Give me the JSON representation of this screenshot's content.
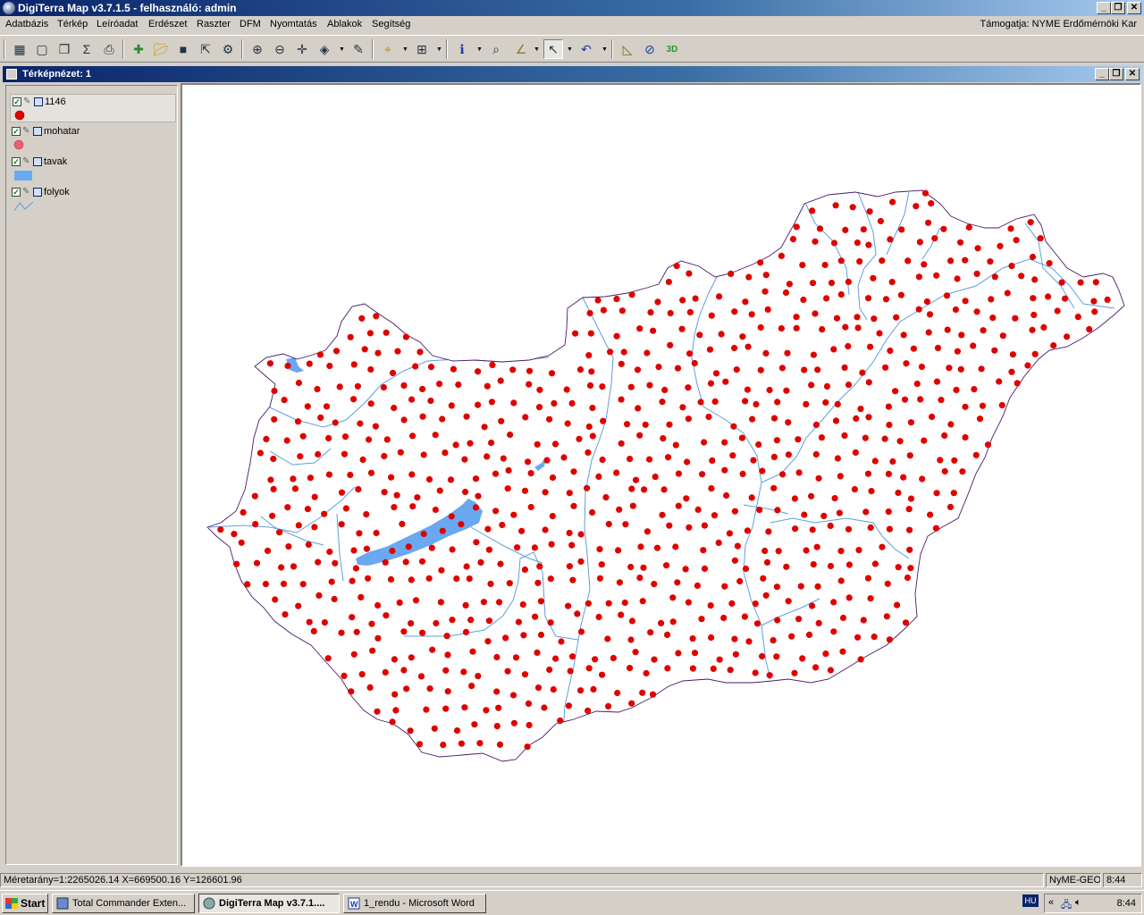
{
  "app": {
    "title": "DigiTerra Map v3.7.1.5 - felhasználó: admin"
  },
  "menu": {
    "items": [
      "Adatbázis",
      "Térkép",
      "Leíróadat",
      "Erdészet",
      "Raszter",
      "DFM",
      "Nyomtatás",
      "Ablakok",
      "Segítség"
    ],
    "support": "Támogatja: NYME Erdőmérnöki Kar"
  },
  "toolbar": {
    "icons": [
      "layers-icon",
      "new-map-icon",
      "window-icon",
      "statistics-icon",
      "print-preview-icon",
      "add-layer-icon",
      "open-icon",
      "save-icon",
      "export-icon",
      "settings-icon",
      "zoom-in-icon",
      "zoom-out-icon",
      "pan-icon",
      "layer-stack-icon",
      "paint-icon",
      "select-point-icon",
      "properties-icon",
      "info-icon",
      "search-icon",
      "measure-icon",
      "label-tool-icon",
      "undo-icon",
      "ruler-icon",
      "compass-icon",
      "3d-icon"
    ]
  },
  "map_window": {
    "title": "Térképnézet: 1"
  },
  "legend": {
    "layers": [
      {
        "name": "1146",
        "checked": true,
        "symbol": "point",
        "color": "#e00000",
        "selected": true
      },
      {
        "name": "mohatar",
        "checked": true,
        "symbol": "point",
        "color": "#f06070",
        "selected": false
      },
      {
        "name": "tavak",
        "checked": true,
        "symbol": "polygon",
        "color": "#6aa8f0",
        "selected": false
      },
      {
        "name": "folyok",
        "checked": true,
        "symbol": "line",
        "color": "#5aa0e0",
        "selected": false
      }
    ]
  },
  "map": {
    "boundary_color": "#4a1a6a",
    "point_color": "#e00000",
    "river_color": "#5aa0e0",
    "lake_color": "#6aa8f0"
  },
  "statusbar": {
    "coords": "Méretarány=1:2265026.14  X=669500.16  Y=126601.96",
    "source": "NyME-GEO",
    "time": "8:44"
  },
  "taskbar": {
    "start_label": "Start",
    "items": [
      {
        "label": "Total Commander Exten...",
        "active": false
      },
      {
        "label": "DigiTerra Map v3.7.1....",
        "active": true
      },
      {
        "label": "1_rendu - Microsoft Word",
        "active": false
      }
    ],
    "lang": "HU",
    "clock": "8:44"
  }
}
